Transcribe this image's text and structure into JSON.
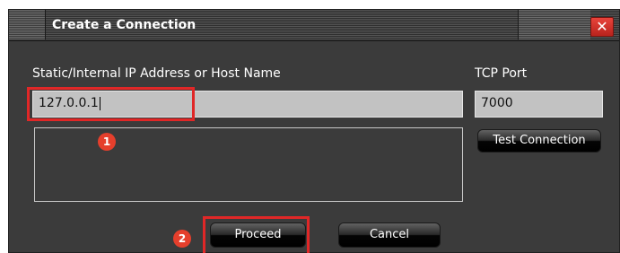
{
  "dialog": {
    "title": "Create a Connection",
    "close_glyph": "✕"
  },
  "form": {
    "ip_label": "Static/Internal IP Address or Host Name",
    "ip_value": "127.0.0.1",
    "port_label": "TCP Port",
    "port_value": "7000"
  },
  "buttons": {
    "test_connection": "Test Connection",
    "proceed": "Proceed",
    "cancel": "Cancel"
  },
  "annotations": {
    "step1": "1",
    "step2": "2",
    "highlight_color": "#e02727",
    "badge_color": "#e53f2c"
  }
}
